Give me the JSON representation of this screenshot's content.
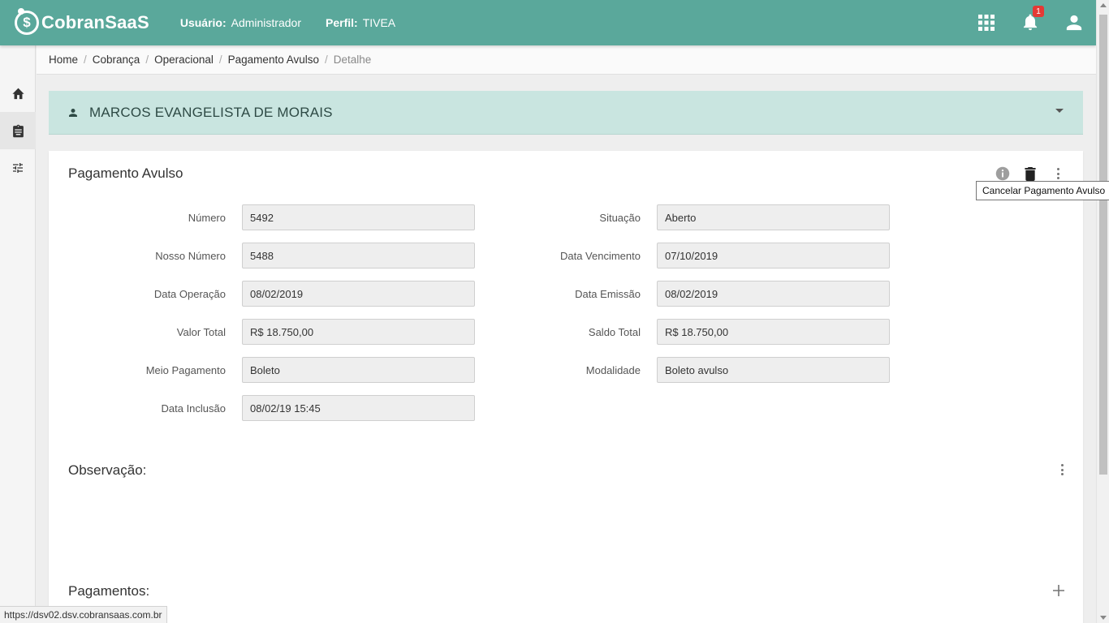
{
  "header": {
    "app_name": "CobranSaaS",
    "logo_symbol": "$",
    "user_label": "Usuário:",
    "user_value": "Administrador",
    "profile_label": "Perfil:",
    "profile_value": "TIVEA",
    "notification_count": "1",
    "bg_color": "#5aa89b",
    "icons": [
      "apps-grid-icon",
      "bell-icon",
      "user-account-icon"
    ]
  },
  "sidebar": {
    "items": [
      {
        "icon": "home-icon",
        "active": false
      },
      {
        "icon": "clipboard-icon",
        "active": true
      },
      {
        "icon": "sliders-icon",
        "active": false
      }
    ]
  },
  "breadcrumb": {
    "items": [
      "Home",
      "Cobrança",
      "Operacional",
      "Pagamento Avulso",
      "Detalhe"
    ],
    "separator": "/"
  },
  "client": {
    "name": "MARCOS EVANGELISTA DE MORAIS",
    "bg_color": "#c9e5e0"
  },
  "payment": {
    "title": "Pagamento Avulso",
    "fields_left": [
      {
        "label": "Número",
        "value": "5492"
      },
      {
        "label": "Nosso Número",
        "value": "5488"
      },
      {
        "label": "Data Operação",
        "value": "08/02/2019"
      },
      {
        "label": "Valor Total",
        "value": "R$ 18.750,00"
      },
      {
        "label": "Meio Pagamento",
        "value": "Boleto"
      },
      {
        "label": "Data Inclusão",
        "value": "08/02/19 15:45"
      }
    ],
    "fields_right": [
      {
        "label": "Situação",
        "value": "Aberto"
      },
      {
        "label": "Data Vencimento",
        "value": "07/10/2019"
      },
      {
        "label": "Data Emissão",
        "value": "08/02/2019"
      },
      {
        "label": "Saldo Total",
        "value": "R$ 18.750,00"
      },
      {
        "label": "Modalidade",
        "value": "Boleto avulso"
      }
    ]
  },
  "tooltip": "Cancelar Pagamento Avulso",
  "observacao": {
    "title": "Observação:"
  },
  "pagamentos": {
    "title": "Pagamentos:"
  },
  "statusbar": {
    "url": "https://dsv02.dsv.cobransaas.com.br"
  }
}
